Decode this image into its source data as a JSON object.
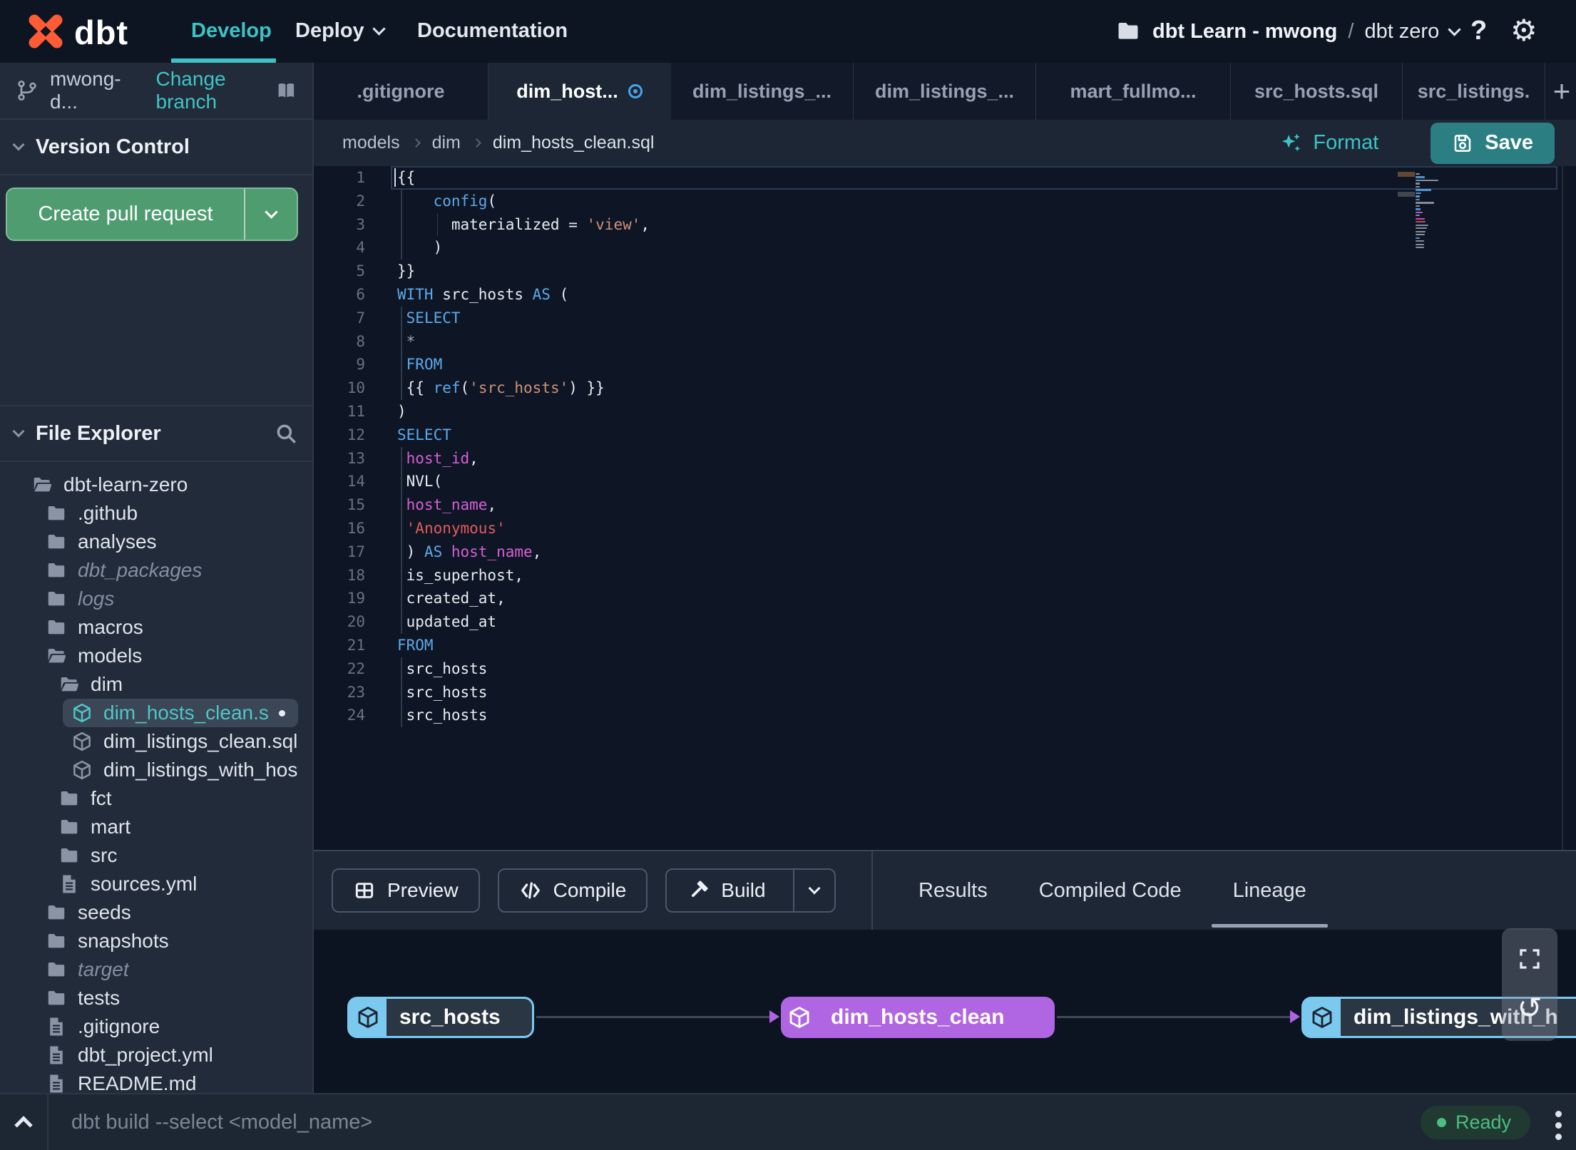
{
  "topnav": {
    "brand": "dbt",
    "menu": [
      {
        "label": "Develop",
        "active": true
      },
      {
        "label": "Deploy",
        "has_chevron": true
      },
      {
        "label": "Documentation"
      }
    ],
    "project": {
      "name": "dbt Learn - mwong",
      "separator": "/",
      "environment": "dbt zero"
    },
    "help_label": "?"
  },
  "branch_bar": {
    "branch_name": "mwong-d...",
    "change_branch_label": "Change branch"
  },
  "version_control": {
    "title": "Version Control",
    "create_pr_label": "Create pull request"
  },
  "file_explorer": {
    "title": "File Explorer",
    "tree": [
      {
        "name": "dbt-learn-zero",
        "level": 0,
        "icon": "folder-open"
      },
      {
        "name": ".github",
        "level": 1,
        "icon": "folder"
      },
      {
        "name": "analyses",
        "level": 1,
        "icon": "folder"
      },
      {
        "name": "dbt_packages",
        "level": 1,
        "icon": "folder",
        "italic": true
      },
      {
        "name": "logs",
        "level": 1,
        "icon": "folder",
        "italic": true
      },
      {
        "name": "macros",
        "level": 1,
        "icon": "folder"
      },
      {
        "name": "models",
        "level": 1,
        "icon": "folder-open"
      },
      {
        "name": "dim",
        "level": 2,
        "icon": "folder-open"
      },
      {
        "name": "dim_hosts_clean.sql",
        "level": 3,
        "icon": "model",
        "selected": true,
        "modified": true
      },
      {
        "name": "dim_listings_clean.sql",
        "level": 3,
        "icon": "model"
      },
      {
        "name": "dim_listings_with_hosts...",
        "level": 3,
        "icon": "model"
      },
      {
        "name": "fct",
        "level": 2,
        "icon": "folder"
      },
      {
        "name": "mart",
        "level": 2,
        "icon": "folder"
      },
      {
        "name": "src",
        "level": 2,
        "icon": "folder"
      },
      {
        "name": "sources.yml",
        "level": 2,
        "icon": "file"
      },
      {
        "name": "seeds",
        "level": 1,
        "icon": "folder"
      },
      {
        "name": "snapshots",
        "level": 1,
        "icon": "folder"
      },
      {
        "name": "target",
        "level": 1,
        "icon": "folder",
        "italic": true
      },
      {
        "name": "tests",
        "level": 1,
        "icon": "folder"
      },
      {
        "name": ".gitignore",
        "level": 1,
        "icon": "file"
      },
      {
        "name": "dbt_project.yml",
        "level": 1,
        "icon": "file"
      },
      {
        "name": "README.md",
        "level": 1,
        "icon": "file"
      }
    ]
  },
  "tabs": [
    {
      "label": ".gitignore"
    },
    {
      "label": "dim_host...",
      "active": true,
      "modified": true
    },
    {
      "label": "dim_listings_..."
    },
    {
      "label": "dim_listings_..."
    },
    {
      "label": "mart_fullmo..."
    },
    {
      "label": "src_hosts.sql"
    },
    {
      "label": "src_listings."
    }
  ],
  "breadcrumb": {
    "path": [
      "models",
      "dim",
      "dim_hosts_clean.sql"
    ]
  },
  "actions": {
    "format_label": "Format",
    "save_label": "Save"
  },
  "editor": {
    "current_line": 1,
    "lines": [
      [
        [
          "{{",
          "p"
        ]
      ],
      [
        [
          "    ",
          "p"
        ],
        [
          "config",
          "k"
        ],
        [
          "(",
          "p"
        ]
      ],
      [
        [
          "      materialized = ",
          "p"
        ],
        [
          "'view'",
          "s"
        ],
        [
          ",",
          "p"
        ]
      ],
      [
        [
          "    )",
          "p"
        ]
      ],
      [
        [
          "}}",
          "p"
        ]
      ],
      [
        [
          "WITH",
          "k"
        ],
        [
          " src_hosts ",
          "p"
        ],
        [
          "AS",
          "k"
        ],
        [
          " (",
          "p"
        ]
      ],
      [
        [
          " ",
          "p"
        ],
        [
          "SELECT",
          "k"
        ]
      ],
      [
        [
          " ",
          "p"
        ],
        [
          "*",
          "o"
        ]
      ],
      [
        [
          " ",
          "p"
        ],
        [
          "FROM",
          "k"
        ]
      ],
      [
        [
          " {{ ",
          "p"
        ],
        [
          "ref",
          "k"
        ],
        [
          "(",
          "p"
        ],
        [
          "'src_hosts'",
          "s"
        ],
        [
          ") }}",
          "p"
        ]
      ],
      [
        [
          ")",
          "p"
        ]
      ],
      [
        [
          "SELECT",
          "k"
        ]
      ],
      [
        [
          " ",
          "p"
        ],
        [
          "host_id",
          "m"
        ],
        [
          ",",
          "p"
        ]
      ],
      [
        [
          " NVL(",
          "p"
        ]
      ],
      [
        [
          " ",
          "p"
        ],
        [
          "host_name",
          "m"
        ],
        [
          ",",
          "p"
        ]
      ],
      [
        [
          " ",
          "p"
        ],
        [
          "'Anonymous'",
          "r"
        ]
      ],
      [
        [
          " ) ",
          "p"
        ],
        [
          "AS",
          "k"
        ],
        [
          " ",
          "p"
        ],
        [
          "host_name",
          "m"
        ],
        [
          ",",
          "p"
        ]
      ],
      [
        [
          " is_superhost,",
          "p"
        ]
      ],
      [
        [
          " created_at,",
          "p"
        ]
      ],
      [
        [
          " updated_at",
          "p"
        ]
      ],
      [
        [
          "FROM",
          "k"
        ]
      ],
      [
        [
          " src_hosts",
          "p"
        ]
      ],
      [
        [
          " src_hosts",
          "p"
        ]
      ],
      [
        [
          " src_hosts",
          "p"
        ]
      ]
    ],
    "guides": [
      {
        "col": 0,
        "from": 2,
        "to": 4
      },
      {
        "col": 4,
        "from": 3,
        "to": 3
      },
      {
        "col": 0,
        "from": 7,
        "to": 10
      },
      {
        "col": 0,
        "from": 13,
        "to": 20
      },
      {
        "col": 0,
        "from": 22,
        "to": 24
      }
    ]
  },
  "bottom_panel": {
    "buttons": [
      {
        "label": "Preview",
        "icon": "table-icon"
      },
      {
        "label": "Compile",
        "icon": "code-icon"
      },
      {
        "label": "Build",
        "icon": "hammer-icon",
        "split": true
      }
    ],
    "tabs": [
      {
        "label": "Results"
      },
      {
        "label": "Compiled Code"
      },
      {
        "label": "Lineage",
        "active": true
      }
    ]
  },
  "lineage": {
    "nodes": [
      {
        "label": "src_hosts",
        "style": "outline"
      },
      {
        "label": "dim_hosts_clean",
        "style": "purple"
      },
      {
        "label": "dim_listings_with_h",
        "style": "outline"
      }
    ]
  },
  "status_bar": {
    "command_placeholder": "dbt build --select <model_name>",
    "status_label": "Ready"
  },
  "colors": {
    "accent_teal": "#3ec2c6",
    "save_teal": "#2b7f82",
    "pr_green": "#4e9c70",
    "lineage_purple": "#b065e2",
    "lineage_blue": "#7cc9f0",
    "code_keyword": "#5da9ea",
    "code_string": "#ce9178",
    "code_string_alt": "#e25b5b",
    "code_identifier": "#d65fd6",
    "status_green": "#4dbd80",
    "modified_blue": "#4aa3e8"
  }
}
